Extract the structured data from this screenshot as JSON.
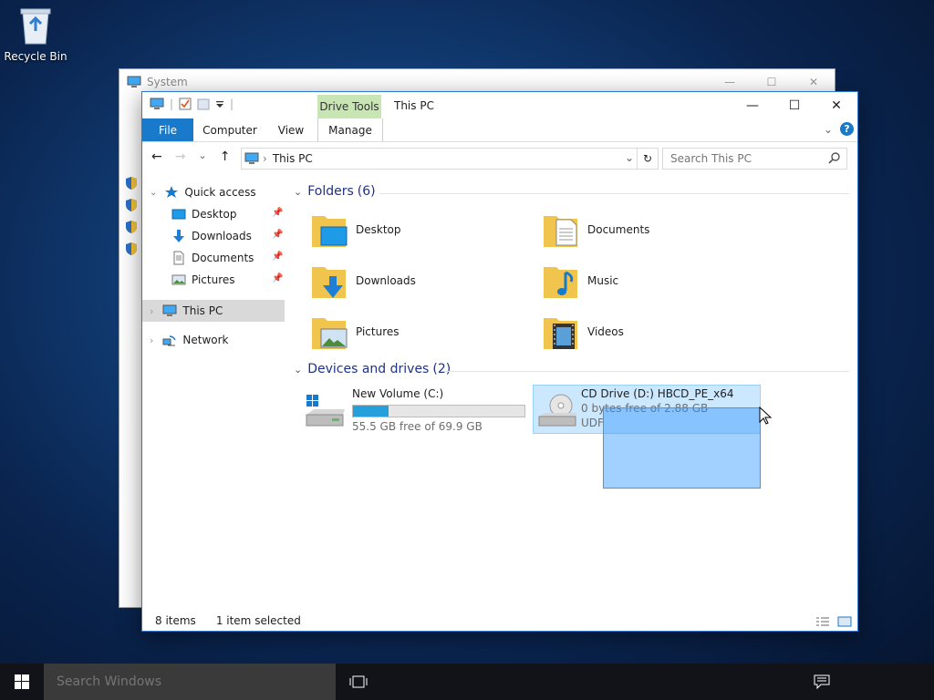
{
  "desktop": {
    "recycle_bin_label": "Recycle Bin"
  },
  "background_window": {
    "title": "System",
    "minimize": "—",
    "maximize": "☐",
    "close": "✕"
  },
  "explorer": {
    "title": "This PC",
    "contextual_tab_group": "Drive Tools",
    "ribbon_tabs": {
      "file": "File",
      "computer": "Computer",
      "view": "View",
      "manage": "Manage"
    },
    "window_controls": {
      "minimize": "—",
      "maximize": "☐",
      "close": "✕"
    },
    "ribbon_expand": "⌄",
    "help": "?",
    "nav_buttons": {
      "back": "←",
      "forward": "→",
      "recent": "⌄",
      "up": "↑"
    },
    "address": {
      "separator": "›",
      "location": "This PC",
      "dropdown": "⌄",
      "refresh": "↻"
    },
    "search": {
      "placeholder": "Search This PC",
      "value": ""
    },
    "nav_pane": {
      "quick_access": "Quick access",
      "quick_items": [
        {
          "label": "Desktop"
        },
        {
          "label": "Downloads"
        },
        {
          "label": "Documents"
        },
        {
          "label": "Pictures"
        }
      ],
      "pin_glyph": "📌",
      "this_pc": "This PC",
      "network": "Network",
      "expander": "›"
    },
    "folders_group": {
      "label": "Folders",
      "count": "(6)",
      "chevron": "⌄"
    },
    "folders": [
      {
        "name": "Desktop"
      },
      {
        "name": "Documents"
      },
      {
        "name": "Downloads"
      },
      {
        "name": "Music"
      },
      {
        "name": "Pictures"
      },
      {
        "name": "Videos"
      }
    ],
    "drives_group": {
      "label": "Devices and drives",
      "count": "(2)",
      "chevron": "⌄"
    },
    "drives": [
      {
        "name": "New Volume (C:)",
        "free": "55.5 GB free of 69.9 GB",
        "used_fraction": 0.21
      },
      {
        "name": "CD Drive (D:) HBCD_PE_x64",
        "free": "0 bytes free of 2.88 GB",
        "fs": "UDF",
        "used_fraction": 1.0
      }
    ],
    "status": {
      "items": "8 items",
      "selected": "1 item selected"
    }
  },
  "taskbar": {
    "search_placeholder": "Search Windows"
  },
  "colors": {
    "accent": "#1979ca",
    "drive_tools_tab": "#c8e6b4",
    "drive_bar": "#26a0da",
    "selection": "#cce8ff",
    "taskbar": "#111318"
  }
}
